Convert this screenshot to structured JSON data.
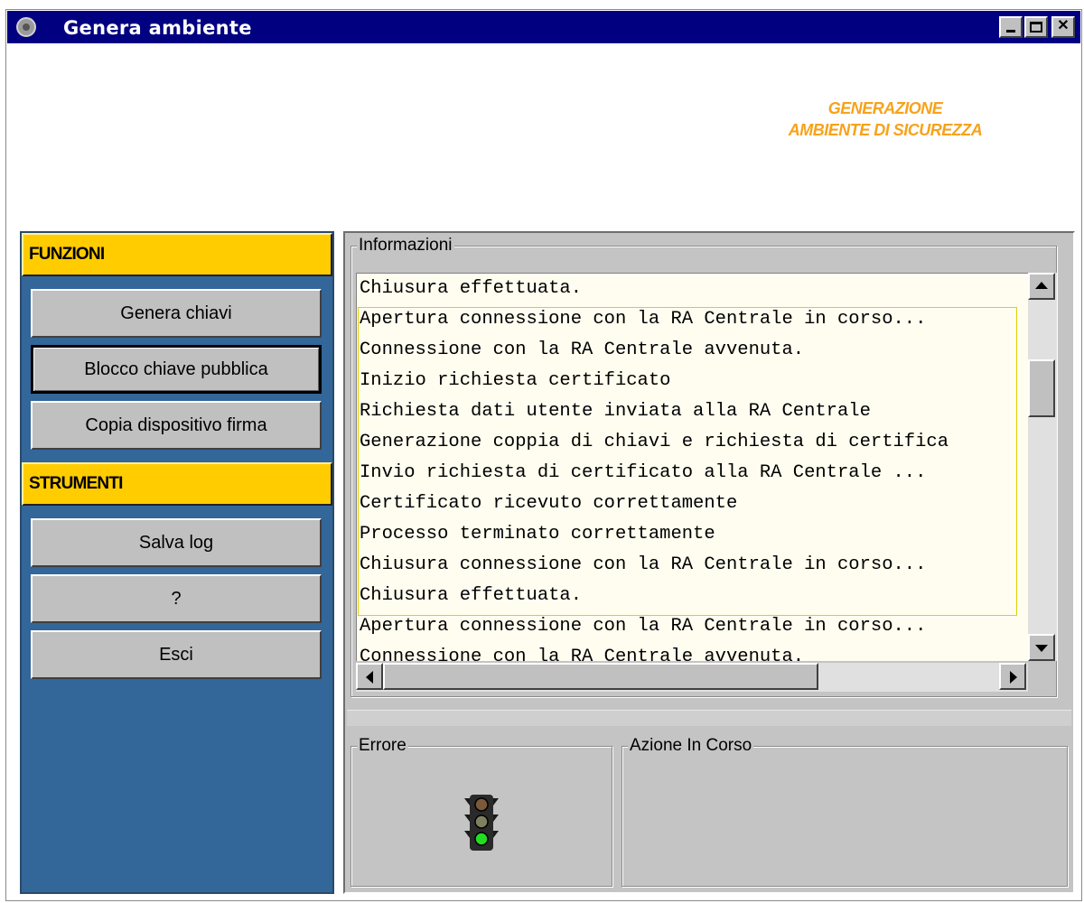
{
  "window": {
    "title": "Genera ambiente"
  },
  "header": {
    "caption_line1": "GENERAZIONE",
    "caption_line2": "AMBIENTE DI SICUREZZA",
    "accent_color": "#f7a21b"
  },
  "left_panel": {
    "background_color": "#336699",
    "sections": [
      {
        "title": "FUNZIONI",
        "buttons": [
          {
            "label": "Genera chiavi"
          },
          {
            "label": "Blocco chiave pubblica",
            "focused": true
          },
          {
            "label": "Copia dispositivo firma"
          }
        ]
      },
      {
        "title": "STRUMENTI",
        "buttons": [
          {
            "label": "Salva log"
          },
          {
            "label": "?"
          },
          {
            "label": "Esci"
          }
        ]
      }
    ]
  },
  "info_panel": {
    "label": "Informazioni",
    "log_lines": [
      "Chiusura effettuata.",
      "Apertura connessione con la RA Centrale in corso...",
      "Connessione con la RA Centrale avvenuta.",
      "Inizio richiesta certificato",
      "Richiesta dati utente inviata alla RA Centrale",
      "Generazione coppia di chiavi e richiesta di certifica",
      "Invio richiesta di certificato alla RA Centrale ...",
      "Certificato ricevuto correttamente",
      "Processo terminato correttamente",
      "Chiusura connessione con la RA Centrale in corso...",
      "Chiusura effettuata.",
      "Apertura connessione con la RA Centrale in corso...",
      "Connessione con la RA Centrale avvenuta."
    ]
  },
  "error_panel": {
    "label": "Errore",
    "status_icon": "traffic-light-icon",
    "active_light": "green"
  },
  "action_panel": {
    "label": "Azione In Corso"
  }
}
